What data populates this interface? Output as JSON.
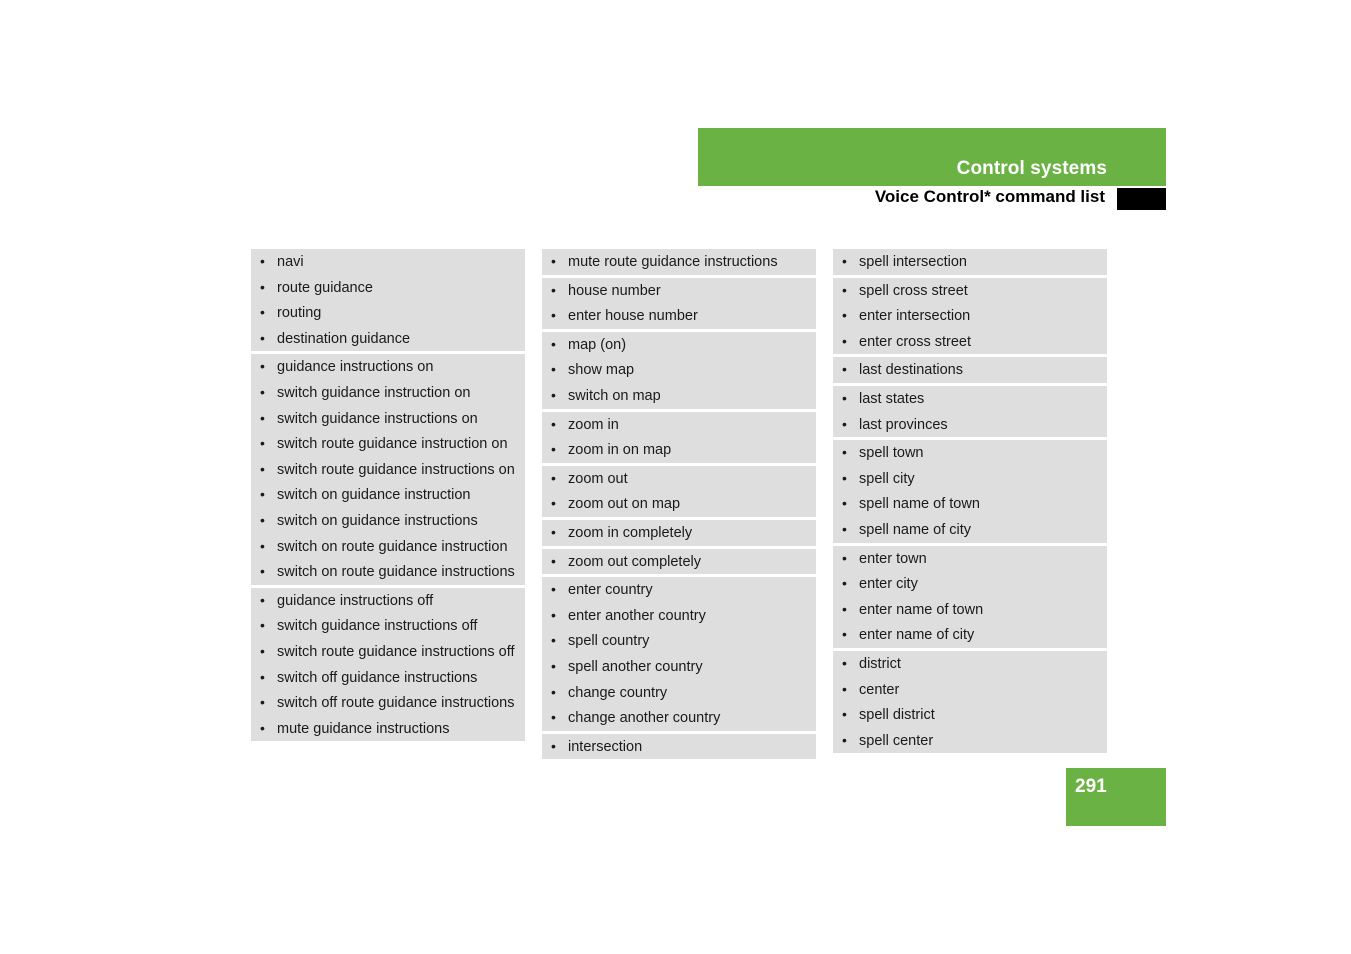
{
  "header": {
    "title": "Control systems",
    "subtitle": "Voice Control* command list",
    "band_color": "#6BB244",
    "marker_color": "#000000"
  },
  "footer": {
    "page_number": "291",
    "block_color": "#6BB244"
  },
  "list_style": {
    "row_background": "#DEDEDE",
    "bullet_glyph": "•",
    "text_color": "#1a1a1a"
  },
  "columns": [
    {
      "id": "column-1",
      "groups": [
        {
          "items": [
            "navi",
            "route guidance",
            "routing",
            "destination guidance"
          ]
        },
        {
          "items": [
            "guidance instructions on",
            "switch guidance instruction on",
            "switch guidance instructions on",
            "switch route guidance instruction on",
            "switch route guidance instructions on",
            "switch on guidance instruction",
            "switch on guidance instructions",
            "switch on route guidance instruction",
            "switch on route guidance instructions"
          ]
        },
        {
          "items": [
            "guidance instructions off",
            "switch guidance instructions off",
            "switch route guidance instructions off",
            "switch off guidance instructions",
            "switch off route guidance instructions",
            "mute guidance instructions"
          ]
        }
      ]
    },
    {
      "id": "column-2",
      "groups": [
        {
          "items": [
            "mute route guidance instructions"
          ]
        },
        {
          "items": [
            "house number",
            "enter house number"
          ]
        },
        {
          "items": [
            "map (on)",
            "show map",
            "switch on map"
          ]
        },
        {
          "items": [
            "zoom in",
            "zoom in on map"
          ]
        },
        {
          "items": [
            "zoom out",
            "zoom out on map"
          ]
        },
        {
          "items": [
            "zoom in completely"
          ]
        },
        {
          "items": [
            "zoom out completely"
          ]
        },
        {
          "items": [
            "enter country",
            "enter another country",
            "spell country",
            "spell another country",
            "change country",
            "change another country"
          ]
        },
        {
          "items": [
            "intersection"
          ]
        }
      ]
    },
    {
      "id": "column-3",
      "groups": [
        {
          "items": [
            "spell intersection"
          ]
        },
        {
          "items": [
            "spell cross street",
            "enter intersection",
            "enter cross street"
          ]
        },
        {
          "items": [
            "last destinations"
          ]
        },
        {
          "items": [
            "last states",
            "last provinces"
          ]
        },
        {
          "items": [
            "spell town",
            "spell city",
            "spell name of town",
            "spell name of city"
          ]
        },
        {
          "items": [
            "enter town",
            "enter city",
            "enter name of town",
            "enter name of city"
          ]
        },
        {
          "items": [
            "district",
            "center",
            "spell district",
            "spell center"
          ]
        }
      ]
    }
  ]
}
